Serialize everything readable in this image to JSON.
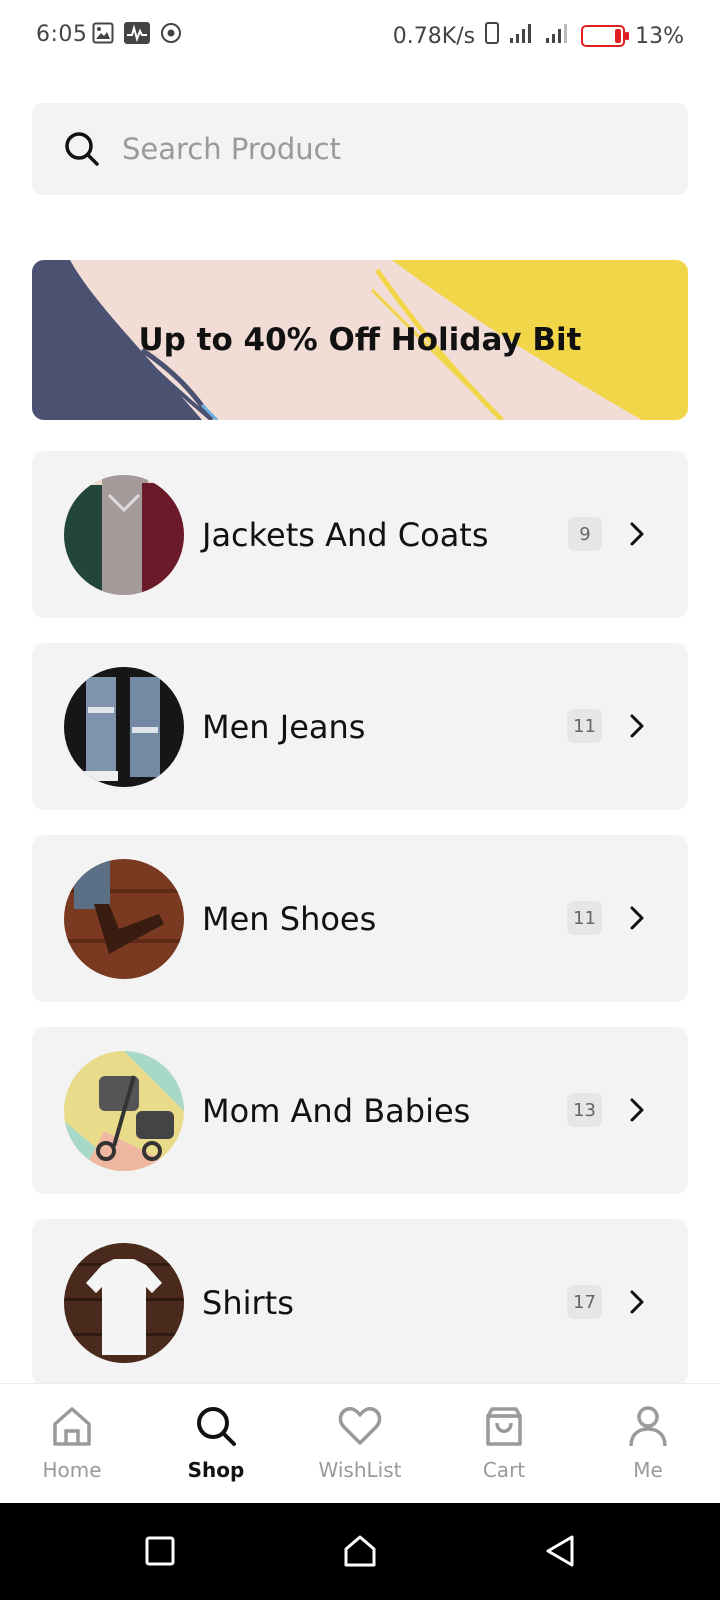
{
  "status_bar": {
    "time": "6:05",
    "net_speed": "0.78K/s",
    "battery": "13%",
    "icons": [
      "image-icon",
      "activity-icon",
      "record-icon",
      "phone-icon",
      "signal-icon",
      "signal-icon",
      "battery-icon"
    ]
  },
  "search": {
    "placeholder": "Search Product"
  },
  "banner": {
    "text": "Up to 40% Off Holiday Bit",
    "colors": {
      "bg": "#f2ddd6",
      "left_shape": "#4b5271",
      "right_shape": "#f2d64a"
    }
  },
  "categories": [
    {
      "name": "Jackets And Coats",
      "count": "9"
    },
    {
      "name": "Men Jeans",
      "count": "11"
    },
    {
      "name": "Men Shoes",
      "count": "11"
    },
    {
      "name": "Mom And Babies",
      "count": "13"
    },
    {
      "name": "Shirts",
      "count": "17"
    }
  ],
  "bottom_nav": [
    {
      "label": "Home",
      "icon": "home-icon",
      "active": false
    },
    {
      "label": "Shop",
      "icon": "search-icon",
      "active": true
    },
    {
      "label": "WishList",
      "icon": "heart-icon",
      "active": false
    },
    {
      "label": "Cart",
      "icon": "bag-icon",
      "active": false
    },
    {
      "label": "Me",
      "icon": "user-icon",
      "active": false
    }
  ],
  "system_nav": {
    "icons": [
      "recents-icon",
      "home-icon",
      "back-icon"
    ]
  }
}
